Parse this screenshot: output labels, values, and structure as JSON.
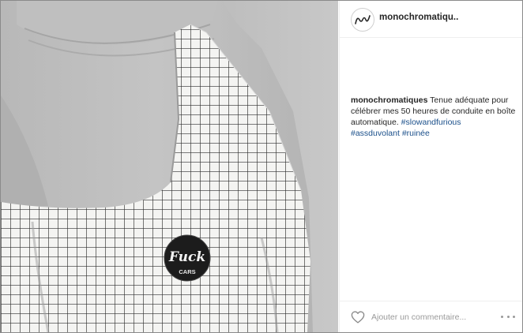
{
  "post": {
    "username": "monochromatiqu..",
    "caption": {
      "username": "monochromatiques",
      "text": " Tenue adéquate pour célébrer mes 50 heures de conduite en boîte automatique. ",
      "hashtags": [
        "#slowandfurious",
        "#assduvolant",
        "#ruinée"
      ]
    },
    "badge": {
      "line1": "Fuck",
      "line2": "CARS"
    }
  },
  "footer": {
    "comment_placeholder": "Ajouter un commentaire..."
  },
  "icons": {
    "avatar": "monochromatiques-logo-icon",
    "like": "heart-outline-icon",
    "more": "more-options-icon"
  },
  "colors": {
    "hashtag": "#1a4f8a",
    "text": "#262626",
    "muted": "#9a9a9a"
  }
}
